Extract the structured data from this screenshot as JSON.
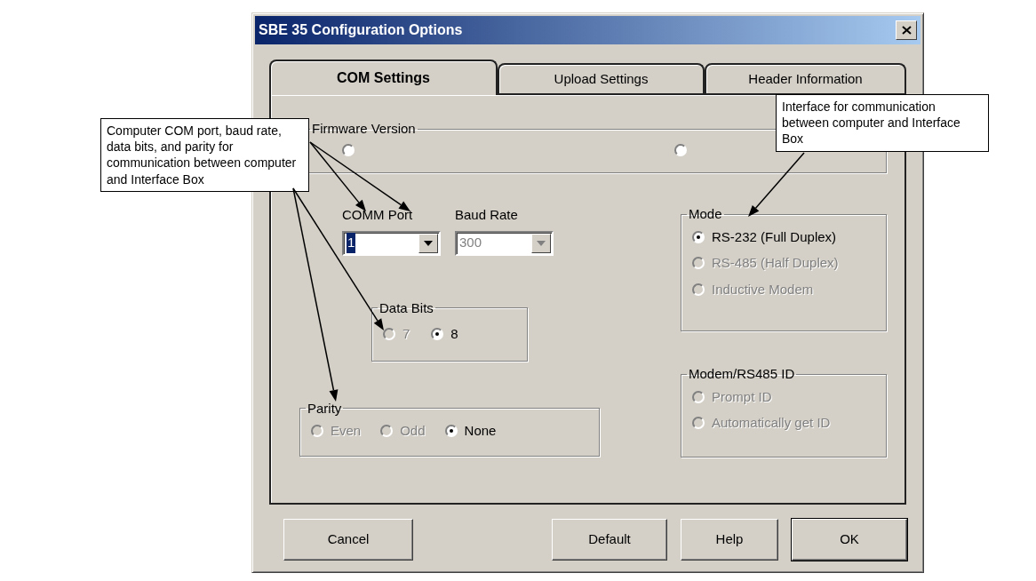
{
  "window": {
    "title": "SBE 35 Configuration Options"
  },
  "tabs": [
    {
      "label": "COM Settings",
      "selected": true
    },
    {
      "label": "Upload Settings",
      "selected": false
    },
    {
      "label": "Header Information",
      "selected": false
    }
  ],
  "firmware_version": {
    "label": "Firmware Version",
    "options": [
      {
        "selected": false,
        "disabled": false
      },
      {
        "selected": false,
        "disabled": false
      }
    ]
  },
  "comm_port": {
    "label": "COMM Port",
    "value": "1",
    "disabled": false,
    "focused": true
  },
  "baud_rate": {
    "label": "Baud Rate",
    "value": "300",
    "disabled": true,
    "focused": false
  },
  "data_bits": {
    "label": "Data Bits",
    "options": [
      {
        "label": "7",
        "selected": false,
        "disabled": true
      },
      {
        "label": "8",
        "selected": true,
        "disabled": false
      }
    ]
  },
  "parity": {
    "label": "Parity",
    "options": [
      {
        "label": "Even",
        "selected": false,
        "disabled": true
      },
      {
        "label": "Odd",
        "selected": false,
        "disabled": true
      },
      {
        "label": "None",
        "selected": true,
        "disabled": false
      }
    ]
  },
  "mode": {
    "label": "Mode",
    "options": [
      {
        "label": "RS-232 (Full Duplex)",
        "selected": true,
        "disabled": false
      },
      {
        "label": "RS-485 (Half Duplex)",
        "selected": false,
        "disabled": true
      },
      {
        "label": "Inductive Modem",
        "selected": false,
        "disabled": true
      }
    ]
  },
  "modem_id": {
    "label": "Modem/RS485 ID",
    "options": [
      {
        "label": "Prompt ID",
        "selected": false,
        "disabled": true
      },
      {
        "label": "Automatically get ID",
        "selected": false,
        "disabled": true
      }
    ]
  },
  "buttons": [
    {
      "label": "Cancel",
      "default": false
    },
    {
      "label": "Default",
      "default": false
    },
    {
      "label": "Help",
      "default": false
    },
    {
      "label": "OK",
      "default": true
    }
  ],
  "callouts": [
    {
      "text": "Computer COM port, baud rate, data bits, and parity for communication between computer and Interface Box"
    },
    {
      "text": "Interface for communication between computer and Interface Box"
    }
  ]
}
